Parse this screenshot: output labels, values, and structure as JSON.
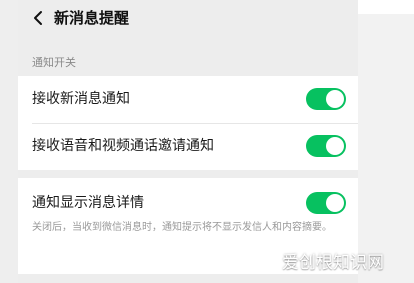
{
  "header": {
    "title": "新消息提醒",
    "back_icon": "chevron-left-icon"
  },
  "section_switch": {
    "label": "通知开关"
  },
  "settings": [
    {
      "label": "接收新消息通知",
      "enabled": true
    },
    {
      "label": "接收语音和视频通话邀请通知",
      "enabled": true
    },
    {
      "label": "通知显示消息详情",
      "enabled": true,
      "description": "关闭后，当收到微信消息时，通知提示将不显示发信人和内容摘要。"
    }
  ],
  "colors": {
    "toggle_on": "#07c160",
    "background": "#ededed",
    "card": "#ffffff"
  },
  "watermark": {
    "text": "爱创根知识网"
  }
}
